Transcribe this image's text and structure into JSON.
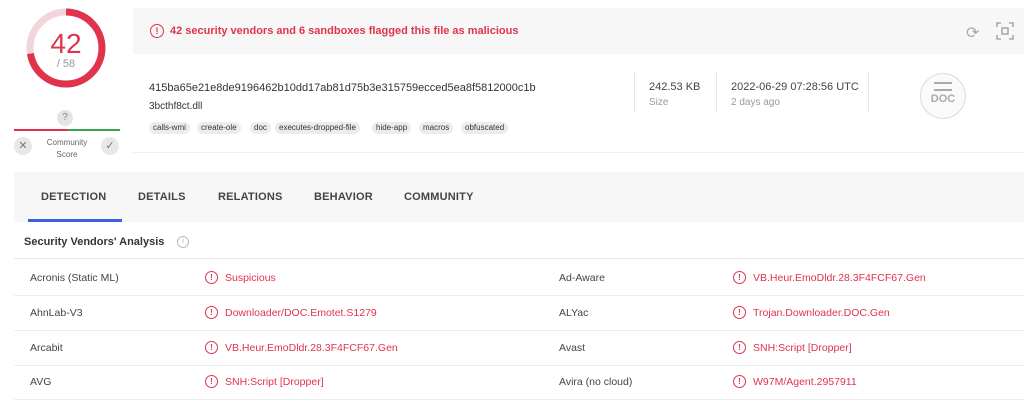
{
  "score": {
    "detected": "42",
    "total": "/ 58",
    "fraction": 0.724,
    "color": "#e0334c"
  },
  "community": {
    "question_mark": "?",
    "label_line1": "Community",
    "label_line2": "Score"
  },
  "alert": {
    "text": "42 security vendors and 6 sandboxes flagged this file as malicious",
    "icon": "alert-circle-icon"
  },
  "file": {
    "hash": "415ba65e21e8de9196462b10dd17ab81d75b3e315759ecced5ea8f5812000c1b",
    "name": "3bcthf8ct.dll",
    "tags": [
      "calls-wmi",
      "create-ole",
      "doc",
      "executes-dropped-file",
      "hide-app",
      "macros",
      "obfuscated"
    ],
    "size_value": "242.53 KB",
    "size_label": "Size",
    "date_value": "2022-06-29 07:28:56 UTC",
    "date_ago": "2 days ago",
    "type_label": "DOC"
  },
  "tabs": [
    {
      "label": "DETECTION",
      "active": true
    },
    {
      "label": "DETAILS"
    },
    {
      "label": "RELATIONS"
    },
    {
      "label": "BEHAVIOR"
    },
    {
      "label": "COMMUNITY"
    }
  ],
  "analysis": {
    "title": "Security Vendors' Analysis",
    "rows": [
      {
        "left_vendor": "Acronis (Static ML)",
        "left_result": "Suspicious",
        "right_vendor": "Ad-Aware",
        "right_result": "VB.Heur.EmoDldr.28.3F4FCF67.Gen"
      },
      {
        "left_vendor": "AhnLab-V3",
        "left_result": "Downloader/DOC.Emotet.S1279",
        "right_vendor": "ALYac",
        "right_result": "Trojan.Downloader.DOC.Gen"
      },
      {
        "left_vendor": "Arcabit",
        "left_result": "VB.Heur.EmoDldr.28.3F4FCF67.Gen",
        "right_vendor": "Avast",
        "right_result": "SNH:Script [Dropper]"
      },
      {
        "left_vendor": "AVG",
        "left_result": "SNH:Script [Dropper]",
        "right_vendor": "Avira (no cloud)",
        "right_result": "W97M/Agent.2957911"
      }
    ]
  }
}
